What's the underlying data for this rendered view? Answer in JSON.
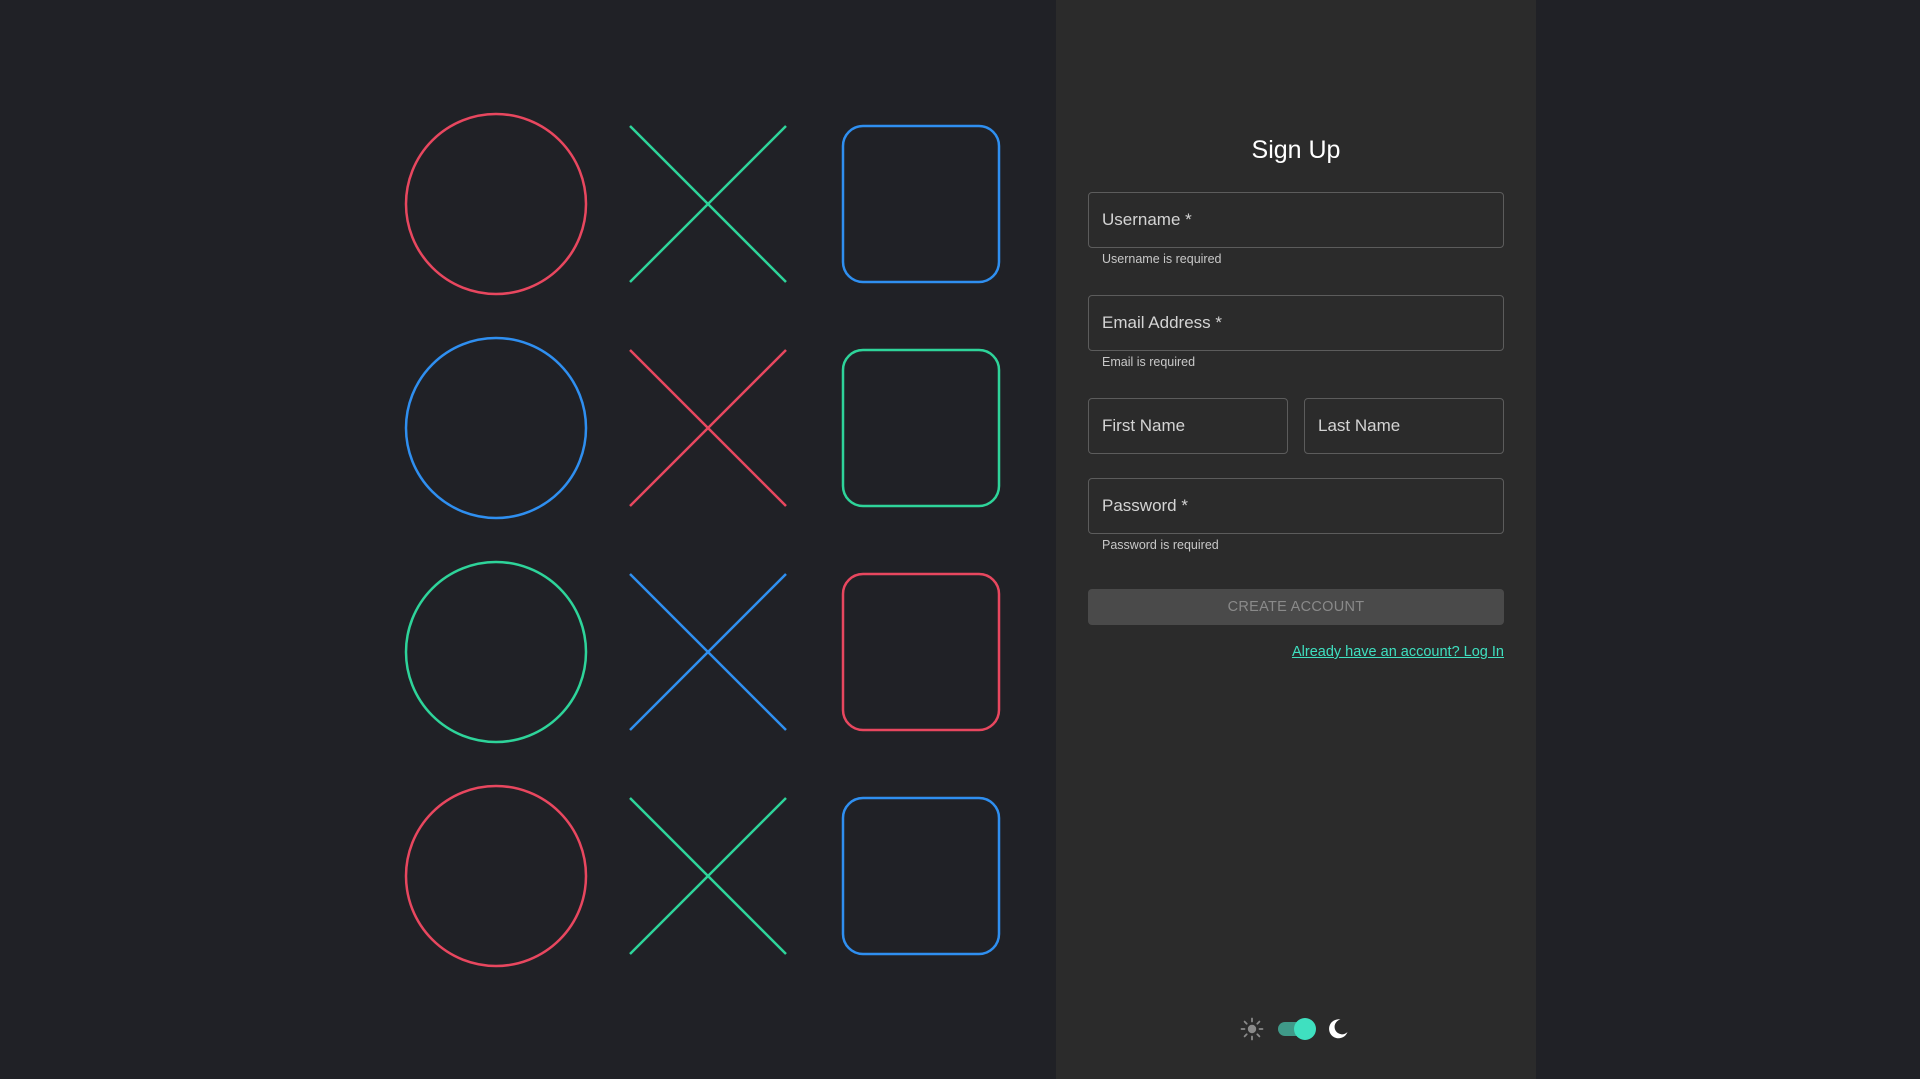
{
  "signup": {
    "title": "Sign Up",
    "username_label": "Username *",
    "username_error": "Username is required",
    "email_label": "Email Address *",
    "email_error": "Email is required",
    "first_name_label": "First Name",
    "last_name_label": "Last Name",
    "password_label": "Password *",
    "password_error": "Password is required",
    "create_button": "CREATE ACCOUNT",
    "login_link": "Already have an account? Log In"
  },
  "theme": {
    "light_icon": "sun-icon",
    "dark_icon": "moon-icon",
    "toggle_state": "dark",
    "accent": "#3fe0c0"
  },
  "decoration": {
    "grid": [
      [
        "circle",
        "cross",
        "square"
      ],
      [
        "circle",
        "cross",
        "square"
      ],
      [
        "circle",
        "cross",
        "square"
      ],
      [
        "circle",
        "cross",
        "square"
      ]
    ],
    "colors": [
      [
        "#e8475f",
        "#2ed49a",
        "#2f8ff0"
      ],
      [
        "#2f8ff0",
        "#e8475f",
        "#2ed49a"
      ],
      [
        "#2ed49a",
        "#2f8ff0",
        "#e8475f"
      ],
      [
        "#e8475f",
        "#2ed49a",
        "#2f8ff0"
      ]
    ]
  }
}
